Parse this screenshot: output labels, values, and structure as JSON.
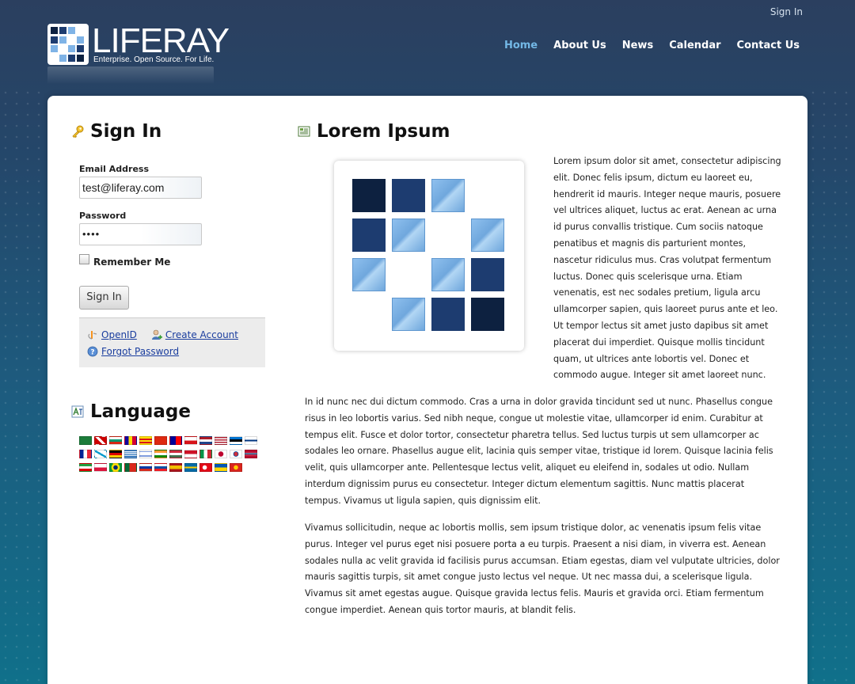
{
  "header": {
    "sign_in_link": "Sign In",
    "logo_text": "LIFERAY",
    "logo_tagline": "Enterprise. Open Source. For Life.",
    "nav": [
      {
        "label": "Home",
        "active": true
      },
      {
        "label": "About Us",
        "active": false
      },
      {
        "label": "News",
        "active": false
      },
      {
        "label": "Calendar",
        "active": false
      },
      {
        "label": "Contact Us",
        "active": false
      }
    ]
  },
  "signin": {
    "title": "Sign In",
    "email_label": "Email Address",
    "email_value": "test@liferay.com",
    "password_label": "Password",
    "password_value": "••••",
    "remember_label": "Remember Me",
    "submit_label": "Sign In",
    "openid_label": "OpenID",
    "create_account_label": "Create Account",
    "forgot_password_label": "Forgot Password"
  },
  "language": {
    "title": "Language",
    "flags": [
      [
        "ar_SA",
        "eu_ES",
        "bg_BG",
        "ca_AD",
        "ca_ES",
        "zh_CN",
        "zh_TW",
        "cs_CZ",
        "nl_NL",
        "en_US",
        "et_EE",
        "fi_FI"
      ],
      [
        "fr_FR",
        "gl_ES",
        "de_DE",
        "el_GR",
        "iw_IL",
        "hi_IN",
        "hu_HU",
        "in_ID",
        "it_IT",
        "ja_JP",
        "ko_KR",
        "nb_NO"
      ],
      [
        "fa_IR",
        "pl_PL",
        "pt_BR",
        "pt_PT",
        "ru_RU",
        "sk_SK",
        "es_ES",
        "sv_SE",
        "tr_TR",
        "uk_UA",
        "vi_VN"
      ]
    ]
  },
  "content": {
    "title": "Lorem Ipsum",
    "para1": "Lorem ipsum dolor sit amet, consectetur adipiscing elit. Donec felis ipsum, dictum eu laoreet eu, hendrerit id mauris. Integer neque mauris, posuere vel ultrices aliquet, luctus ac erat. Aenean ac urna id purus convallis tristique. Cum sociis natoque penatibus et magnis dis parturient montes, nascetur ridiculus mus. Cras volutpat fermentum luctus. Donec quis scelerisque urna. Etiam venenatis, est nec sodales pretium, ligula arcu ullamcorper sapien, quis laoreet purus ante et leo. Ut tempor lectus sit amet justo dapibus sit amet placerat dui imperdiet. Quisque mollis tincidunt quam, ut ultrices ante lobortis vel. Donec et commodo augue. Integer sit amet laoreet nunc.",
    "para2": "In id nunc nec dui dictum commodo. Cras a urna in dolor gravida tincidunt sed ut nunc. Phasellus congue risus in leo lobortis varius. Sed nibh neque, congue ut molestie vitae, ullamcorper id enim. Curabitur at tempus elit. Fusce et dolor tortor, consectetur pharetra tellus. Sed luctus turpis ut sem ullamcorper ac sodales leo ornare. Phasellus augue elit, lacinia quis semper vitae, tristique id lorem. Quisque lacinia felis velit, quis ullamcorper ante. Pellentesque lectus velit, aliquet eu eleifend in, sodales ut odio. Nullam interdum dignissim purus eu consectetur. Integer dictum elementum sagittis. Nunc mattis placerat tempus. Vivamus ut ligula sapien, quis dignissim elit.",
    "para3": "Vivamus sollicitudin, neque ac lobortis mollis, sem ipsum tristique dolor, ac venenatis ipsum felis vitae purus. Integer vel purus eget nisi posuere porta a eu turpis. Praesent a nisi diam, in viverra est. Aenean sodales nulla ac velit gravida id facilisis purus accumsan. Etiam egestas, diam vel vulputate ultricies, dolor mauris sagittis turpis, sit amet congue justo lectus vel neque. Ut nec massa dui, a scelerisque ligula. Vivamus sit amet egestas augue. Quisque gravida lectus felis. Mauris et gravida orci. Etiam fermentum congue imperdiet. Aenean quis tortor mauris, at blandit felis."
  },
  "colors": {
    "accent_nav_active": "#73b8e6",
    "link": "#1a3d9e",
    "logo_dark": "#0d2140",
    "logo_mid": "#1d3c70",
    "logo_light": "#7fb3e6"
  }
}
